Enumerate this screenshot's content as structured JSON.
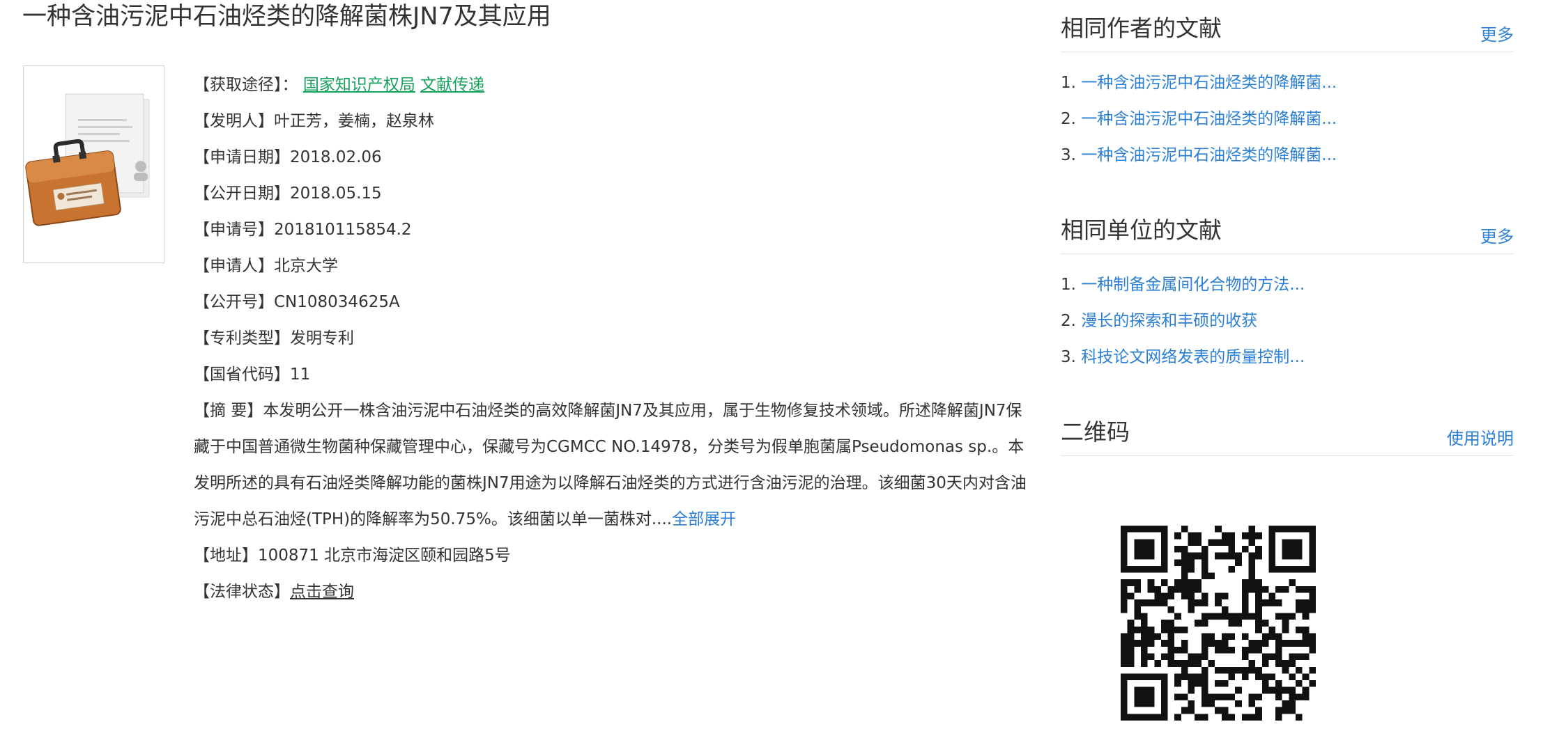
{
  "title": "一种含油污泥中石油烃类的降解菌株JN7及其应用",
  "info": {
    "access_label": "【获取途径】：",
    "access_link1": "国家知识产权局",
    "access_link2": "文献传递",
    "inventor_label": "【发明人】",
    "inventor": "叶正芳，姜楠，赵泉林",
    "apply_date_label": "【申请日期】",
    "apply_date": "2018.02.06",
    "pub_date_label": "【公开日期】",
    "pub_date": "2018.05.15",
    "apply_no_label": "【申请号】",
    "apply_no": "201810115854.2",
    "applicant_label": "【申请人】",
    "applicant": "北京大学",
    "pub_no_label": "【公开号】",
    "pub_no": "CN108034625A",
    "type_label": "【专利类型】",
    "type": "发明专利",
    "code_label": "【国省代码】",
    "code": "11",
    "abstract_label": "【摘 要】",
    "abstract": "本发明公开一株含油污泥中石油烃类的高效降解菌JN7及其应用，属于生物修复技术领域。所述降解菌JN7保藏于中国普通微生物菌种保藏管理中心，保藏号为CGMCC NO.14978，分类号为假单胞菌属Pseudomonas sp.。本发明所述的具有石油烃类降解功能的菌株JN7用途为以降解石油烃类的方式进行含油污泥的治理。该细菌30天内对含油污泥中总石油烃(TPH)的降解率为50.75%。该细菌以单一菌株对....",
    "expand": "全部展开",
    "address_label": "【地址】",
    "address": "100871 北京市海淀区颐和园路5号",
    "legal_label": "【法律状态】",
    "legal_link": "点击查询"
  },
  "sidebar": {
    "same_author": {
      "heading": "相同作者的文献",
      "more": "更多",
      "items": [
        {
          "num": "1.",
          "text": "一种含油污泥中石油烃类的降解菌..."
        },
        {
          "num": "2.",
          "text": "一种含油污泥中石油烃类的降解菌..."
        },
        {
          "num": "3.",
          "text": "一种含油污泥中石油烃类的降解菌..."
        }
      ]
    },
    "same_org": {
      "heading": "相同单位的文献",
      "more": "更多",
      "items": [
        {
          "num": "1.",
          "text": "一种制备金属间化合物的方法..."
        },
        {
          "num": "2.",
          "text": "漫长的探索和丰硕的收获"
        },
        {
          "num": "3.",
          "text": "科技论文网络发表的质量控制..."
        }
      ]
    },
    "qrcode": {
      "heading": "二维码",
      "help": "使用说明"
    }
  },
  "colors": {
    "link_blue": "#2b7fd4",
    "link_green": "#17a05e",
    "text": "#333333"
  }
}
